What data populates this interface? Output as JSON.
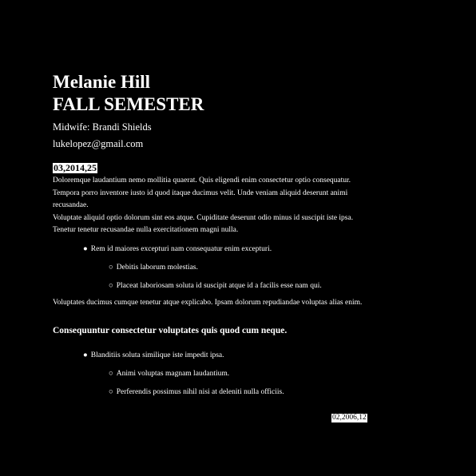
{
  "header": {
    "name": "Melanie Hill",
    "title": "FALL SEMESTER",
    "midwife": "Midwife: Brandi Shields",
    "email": "lukelopez@gmail.com",
    "date": "03,2014,25"
  },
  "body": {
    "paragraph1": "Doloremque laudantium nemo mollitia quaerat. Quis eligendi enim consectetur optio consequatur. Tempora porro inventore iusto id quod itaque ducimus velit. Unde veniam aliquid deserunt animi recusandae.",
    "paragraph2": "Voluptate aliquid optio dolorum sint eos atque. Cupiditate deserunt odio minus id suscipit iste ipsa. Tenetur tenetur recusandae nulla exercitationem magni nulla.",
    "list1": {
      "item": "Rem id maiores excepturi nam consequatur enim excepturi.",
      "subitems": [
        "Debitis laborum molestias.",
        "Placeat laboriosam soluta id suscipit atque id a facilis esse nam qui."
      ]
    },
    "paragraph3": "Voluptates ducimus cumque tenetur atque explicabo. Ipsam dolorum repudiandae voluptas alias enim.",
    "subheading": "Consequuntur consectetur voluptates quis quod cum neque.",
    "list2": {
      "item": "Blanditiis soluta similique iste impedit ipsa.",
      "subitems": [
        "Animi voluptas magnam laudantium.",
        "Perferendis possimus nihil nisi at deleniti nulla officiis."
      ]
    }
  },
  "footer": {
    "date": "02,2006,12"
  },
  "glyphs": {
    "bullet": "●",
    "circle": "○"
  }
}
